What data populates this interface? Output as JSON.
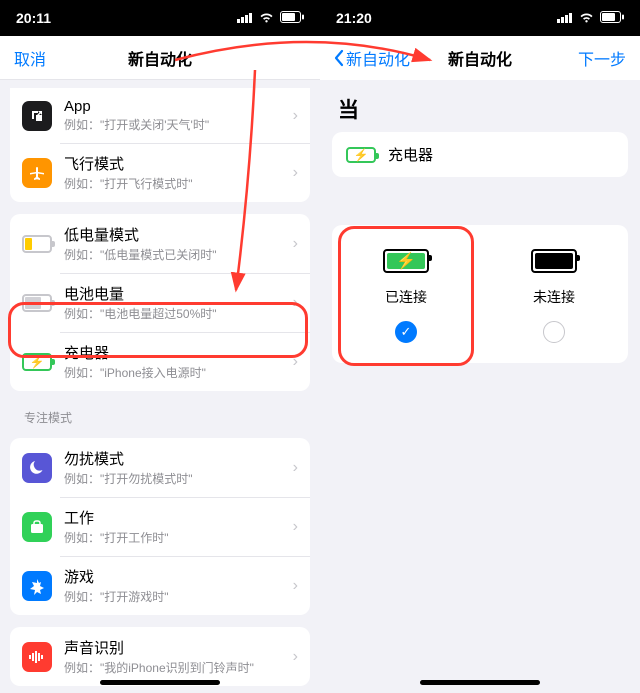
{
  "left": {
    "status_time": "20:11",
    "nav": {
      "cancel": "取消",
      "title": "新自动化"
    },
    "rows": {
      "app": {
        "title": "App",
        "sub": "例如：\"打开或关闭'天气'时\""
      },
      "airplane": {
        "title": "飞行模式",
        "sub": "例如：\"打开飞行模式时\""
      },
      "low_power": {
        "title": "低电量模式",
        "sub": "例如：\"低电量模式已关闭时\""
      },
      "battery_level": {
        "title": "电池电量",
        "sub": "例如：\"电池电量超过50%时\""
      },
      "charger": {
        "title": "充电器",
        "sub": "例如：\"iPhone接入电源时\""
      },
      "focus_header": "专注模式",
      "dnd": {
        "title": "勿扰模式",
        "sub": "例如：\"打开勿扰模式时\""
      },
      "work": {
        "title": "工作",
        "sub": "例如：\"打开工作时\""
      },
      "game": {
        "title": "游戏",
        "sub": "例如：\"打开游戏时\""
      },
      "sound": {
        "title": "声音识别",
        "sub": "例如：\"我的iPhone识别到门铃声时\""
      }
    }
  },
  "right": {
    "status_time": "21:20",
    "nav": {
      "back": "新自动化",
      "title": "新自动化",
      "next": "下一步"
    },
    "when_label": "当",
    "charger_label": "充电器",
    "options": {
      "connected": "已连接",
      "disconnected": "未连接"
    }
  },
  "colors": {
    "blue": "#007aff",
    "red": "#ff3b30",
    "green": "#34c759",
    "orange": "#ff9500",
    "gray": "#8e8e93",
    "yellow": "#ffcc00",
    "indigo": "#5856d6"
  }
}
